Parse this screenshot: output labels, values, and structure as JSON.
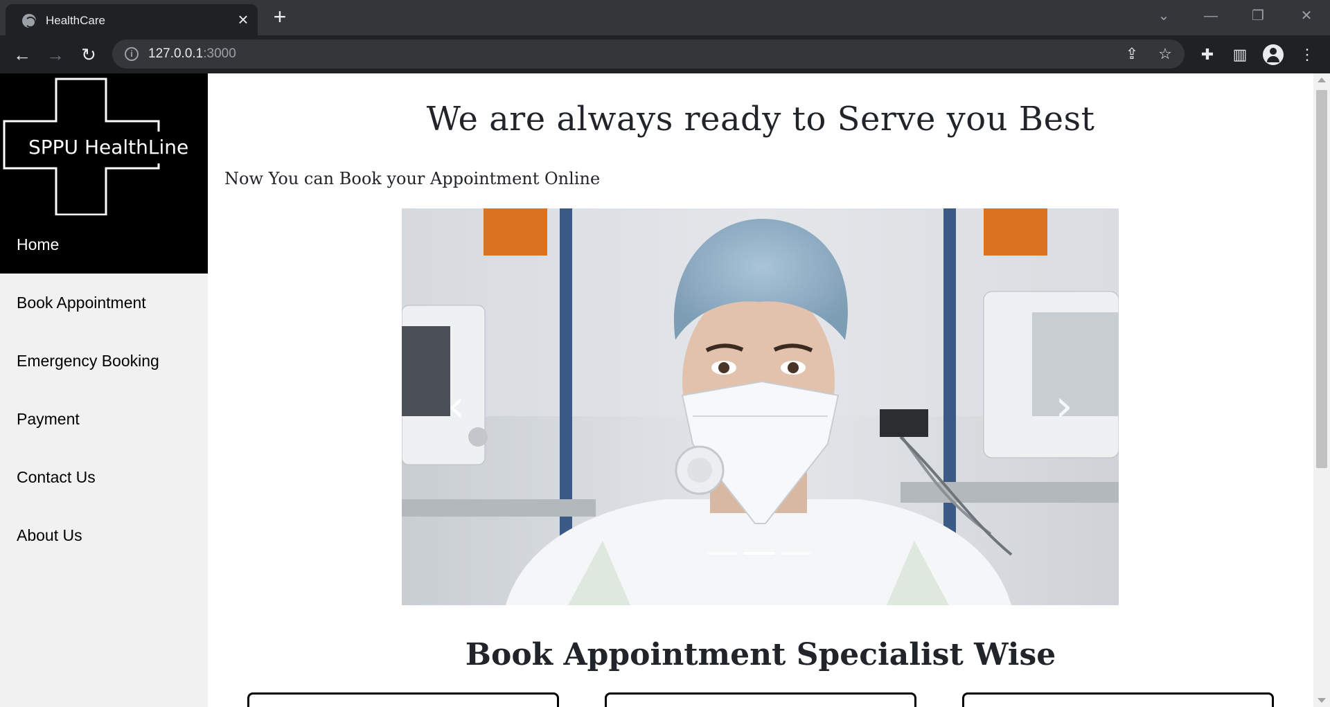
{
  "browser": {
    "tab_title": "HealthCare",
    "tab_close": "×",
    "new_tab": "+",
    "url_host": "127.0.0.1",
    "url_port": ":3000"
  },
  "sidebar": {
    "logo_text": "SPPU HealthLine",
    "items": [
      {
        "label": "Home",
        "active": true
      },
      {
        "label": "Book Appointment"
      },
      {
        "label": "Emergency Booking"
      },
      {
        "label": "Payment"
      },
      {
        "label": "Contact Us"
      },
      {
        "label": "About Us"
      }
    ]
  },
  "main": {
    "headline": "We are always ready to Serve you Best",
    "subline": "Now You can Book your Appointment Online",
    "carousel": {
      "slide_count": 3,
      "active_index": 1,
      "prev_icon": "‹",
      "next_icon": "›"
    },
    "section_title": "Book Appointment Specialist Wise"
  },
  "colors": {
    "sidebar_active_bg": "#000000",
    "sidebar_bg": "#f1f1f1",
    "text": "#212529"
  }
}
